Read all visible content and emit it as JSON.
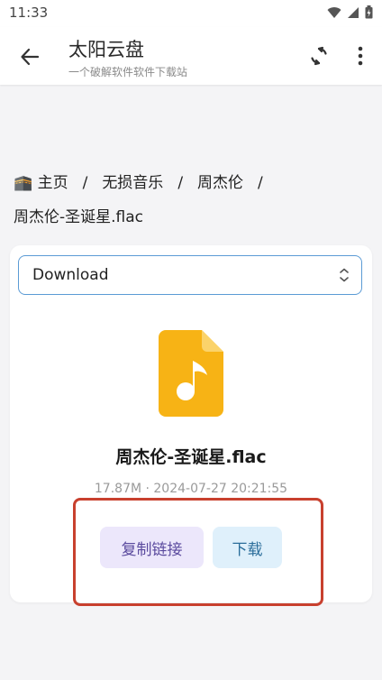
{
  "status_bar": {
    "time": "11:33"
  },
  "app_bar": {
    "title": "太阳云盘",
    "subtitle": "一个破解软件软件下载站"
  },
  "breadcrumb": {
    "home_icon": "🕋",
    "items": [
      "主页",
      "无损音乐",
      "周杰伦"
    ],
    "separator": "/",
    "current": "周杰伦-圣诞星.flac"
  },
  "folder_select": {
    "value": "Download"
  },
  "file": {
    "name": "周杰伦-圣诞星.flac",
    "meta": "17.87M · 2024-07-27 20:21:55",
    "icon": "music-file-icon",
    "icon_color": "#f7b315"
  },
  "actions": {
    "copy_link": "复制链接",
    "download": "下载"
  },
  "colors": {
    "accent_border": "#5b9bd5",
    "highlight": "#c8402e"
  }
}
